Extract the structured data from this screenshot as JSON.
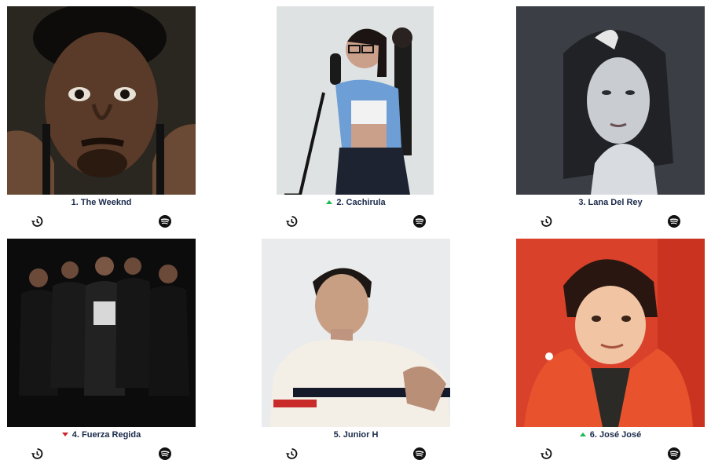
{
  "artists": [
    {
      "rank_label": "1. The Weeknd",
      "trend": "none",
      "history_icon": "history-icon",
      "spotify_icon": "spotify-icon"
    },
    {
      "rank_label": "2. Cachirula",
      "trend": "up",
      "history_icon": "history-icon",
      "spotify_icon": "spotify-icon"
    },
    {
      "rank_label": "3. Lana Del Rey",
      "trend": "none",
      "history_icon": "history-icon",
      "spotify_icon": "spotify-icon"
    },
    {
      "rank_label": "4. Fuerza Regida",
      "trend": "down",
      "history_icon": "history-icon",
      "spotify_icon": "spotify-icon"
    },
    {
      "rank_label": "5. Junior H",
      "trend": "none",
      "history_icon": "history-icon",
      "spotify_icon": "spotify-icon"
    },
    {
      "rank_label": "6. José José",
      "trend": "up",
      "history_icon": "history-icon",
      "spotify_icon": "spotify-icon"
    }
  ],
  "colors": {
    "trend_up": "#1db954",
    "trend_down": "#d0232f",
    "name_text": "#1a2a4a"
  }
}
